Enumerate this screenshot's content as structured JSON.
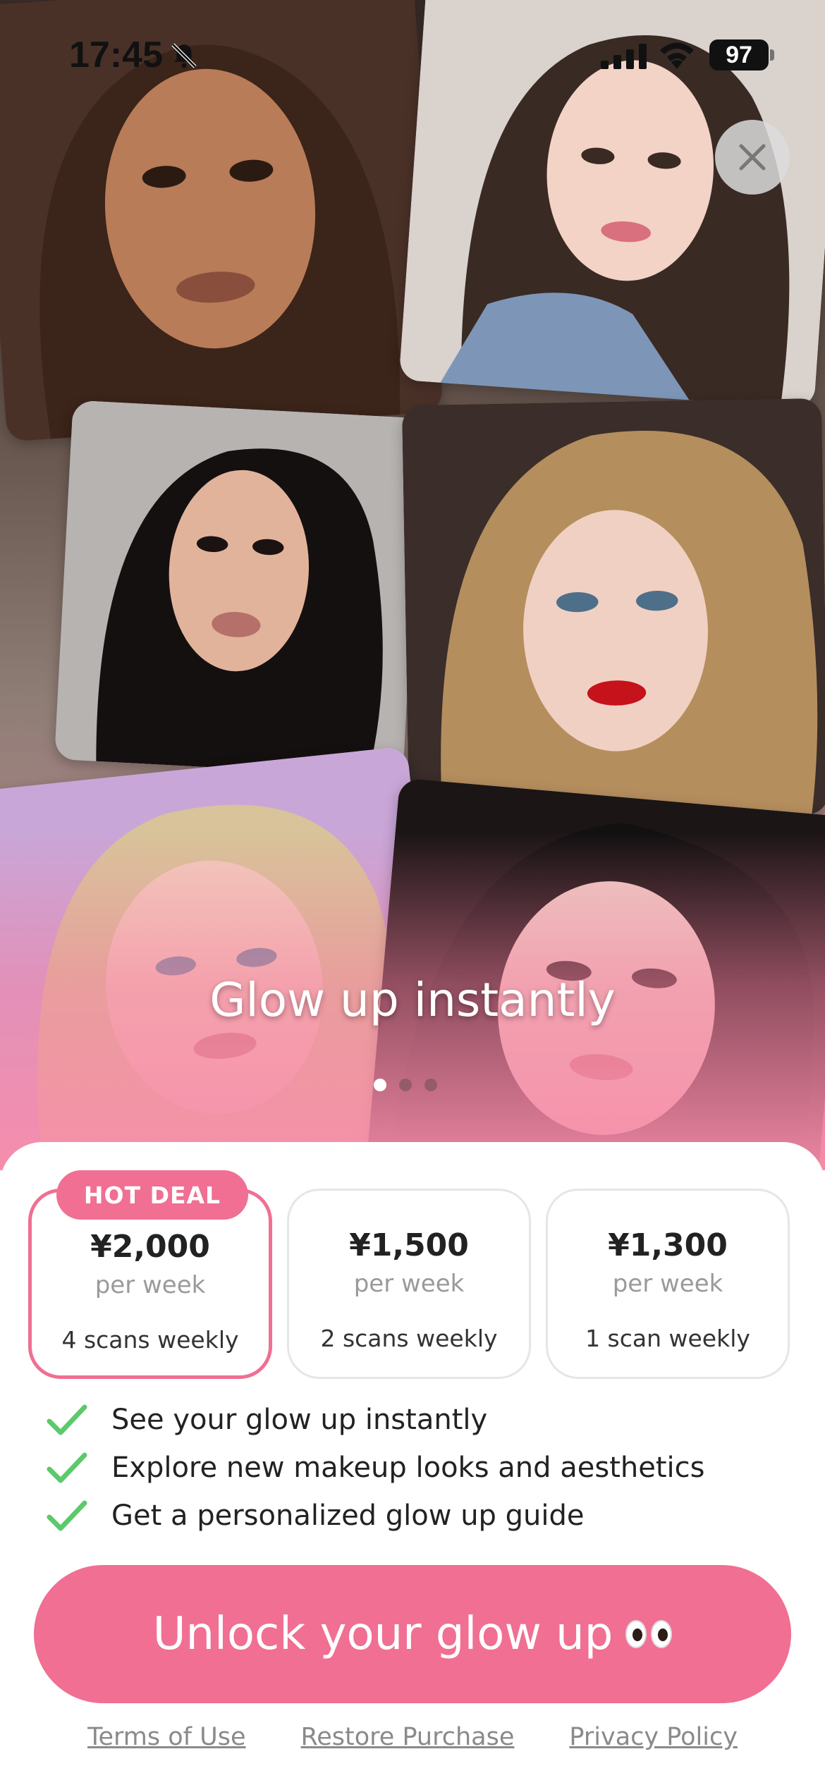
{
  "status_bar": {
    "time": "17:45",
    "battery": "97"
  },
  "hero": {
    "title": "Glow up instantly",
    "pagination": {
      "total": 3,
      "active": 1
    }
  },
  "plans": [
    {
      "price": "¥2,000",
      "period": "per week",
      "scans": "4 scans weekly",
      "badge": "HOT DEAL",
      "selected": true
    },
    {
      "price": "¥1,500",
      "period": "per week",
      "scans": "2 scans weekly",
      "selected": false
    },
    {
      "price": "¥1,300",
      "period": "per week",
      "scans": "1 scan weekly",
      "selected": false
    }
  ],
  "features": [
    "See your glow up instantly",
    "Explore new makeup looks and aesthetics",
    "Get a personalized glow up guide"
  ],
  "cta": {
    "label": "Unlock your glow up"
  },
  "footer": {
    "terms": "Terms of Use",
    "restore": "Restore Purchase",
    "privacy": "Privacy Policy"
  },
  "colors": {
    "accent": "#f06f92",
    "check": "#5cc96b"
  },
  "icons": [
    "bell-muted-icon",
    "cellular-signal-icon",
    "wifi-icon",
    "battery-icon",
    "close-icon",
    "check-icon",
    "eyes-emoji-icon"
  ]
}
